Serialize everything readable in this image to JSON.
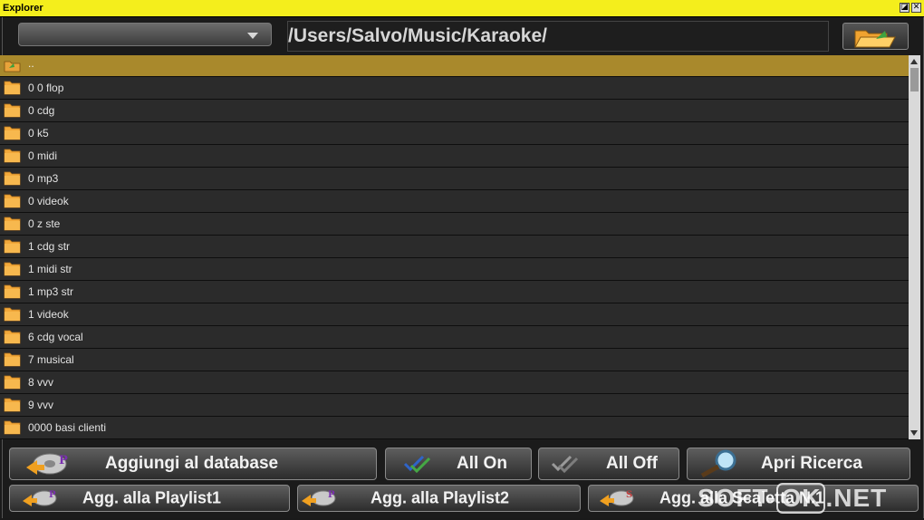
{
  "window": {
    "title": "Explorer",
    "restore_glyph": "◪",
    "close_glyph": "✕"
  },
  "toolbar": {
    "dropdown_value": "",
    "path": "/Users/Salvo/Music/Karaoke/",
    "open_folder_icon": "folder-open-icon"
  },
  "list": {
    "parent_label": "..",
    "items": [
      {
        "label": "0 0 flop"
      },
      {
        "label": "0 cdg"
      },
      {
        "label": "0 k5"
      },
      {
        "label": "0 midi"
      },
      {
        "label": "0 mp3"
      },
      {
        "label": "0 videok"
      },
      {
        "label": "0 z ste"
      },
      {
        "label": "1 cdg str"
      },
      {
        "label": "1 midi str"
      },
      {
        "label": "1 mp3 str"
      },
      {
        "label": "1 videok"
      },
      {
        "label": "6 cdg vocal"
      },
      {
        "label": "7 musical"
      },
      {
        "label": "8 vvv"
      },
      {
        "label": "9 vvv"
      },
      {
        "label": "0000 basi clienti"
      }
    ]
  },
  "buttons": {
    "add_database": "Aggiungi al database",
    "all_on": "All On",
    "all_off": "All Off",
    "open_search": "Apri Ricerca",
    "add_playlist1": "Agg. alla Playlist1",
    "add_playlist2": "Agg. alla Playlist2",
    "add_scaletta": "Agg. alla Scaletta N.1"
  },
  "watermark": {
    "part1": "SOFT-",
    "part2": "OK",
    "part3": ".NET"
  },
  "colors": {
    "title_bar": "#f4ee1c",
    "selected_row": "#a9892c",
    "folder": "#f2a93b"
  }
}
